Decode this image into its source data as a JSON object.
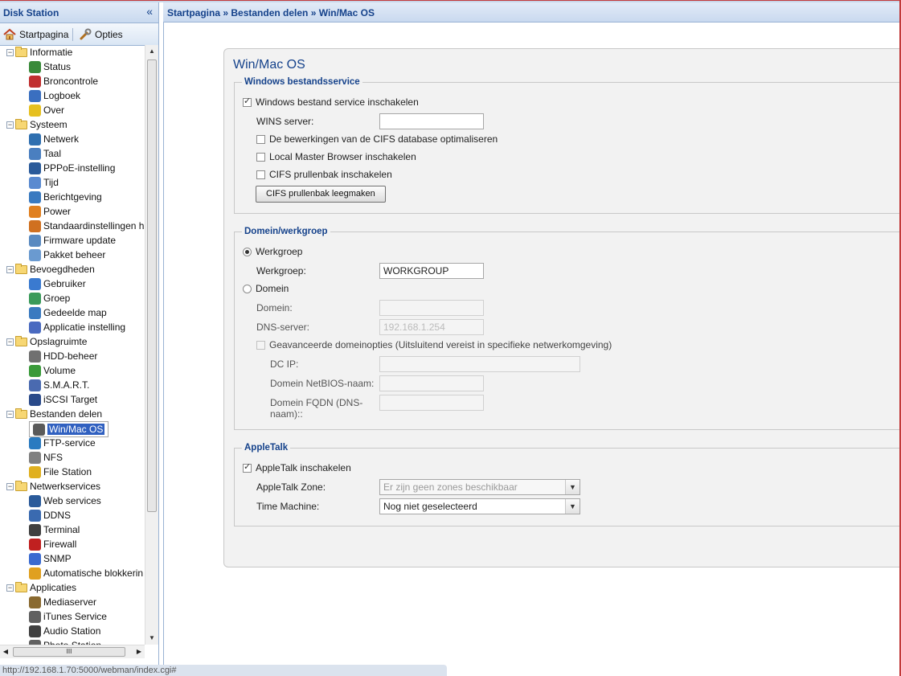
{
  "sidebar": {
    "title": "Disk Station",
    "collapse_glyph": "«",
    "toolbar": {
      "home_label": "Startpagina",
      "options_label": "Opties"
    },
    "tree": [
      {
        "type": "folder",
        "label": "Informatie"
      },
      {
        "type": "item",
        "label": "Status",
        "icon": "status-icon",
        "color": "#3a8a3a"
      },
      {
        "type": "item",
        "label": "Broncontrole",
        "icon": "resource-monitor-icon",
        "color": "#c03030"
      },
      {
        "type": "item",
        "label": "Logboek",
        "icon": "log-icon",
        "color": "#3a6fc0"
      },
      {
        "type": "item",
        "label": "Over",
        "icon": "lightbulb-icon",
        "color": "#e6c020"
      },
      {
        "type": "folder",
        "label": "Systeem"
      },
      {
        "type": "item",
        "label": "Netwerk",
        "icon": "network-icon",
        "color": "#2f6fb0"
      },
      {
        "type": "item",
        "label": "Taal",
        "icon": "language-icon",
        "color": "#4a7fc0"
      },
      {
        "type": "item",
        "label": "PPPoE-instelling",
        "icon": "pppoe-icon",
        "color": "#2a5a9a"
      },
      {
        "type": "item",
        "label": "Tijd",
        "icon": "clock-icon",
        "color": "#5a8ad0"
      },
      {
        "type": "item",
        "label": "Berichtgeving",
        "icon": "notification-icon",
        "color": "#3a7ac0"
      },
      {
        "type": "item",
        "label": "Power",
        "icon": "power-icon",
        "color": "#e08020"
      },
      {
        "type": "item",
        "label": "Standaardinstellingen h",
        "icon": "restore-defaults-icon",
        "color": "#d07020"
      },
      {
        "type": "item",
        "label": "Firmware update",
        "icon": "firmware-icon",
        "color": "#5a8ac0"
      },
      {
        "type": "item",
        "label": "Pakket beheer",
        "icon": "package-icon",
        "color": "#6a9ad0"
      },
      {
        "type": "folder",
        "label": "Bevoegdheden"
      },
      {
        "type": "item",
        "label": "Gebruiker",
        "icon": "user-icon",
        "color": "#3a7ad0"
      },
      {
        "type": "item",
        "label": "Groep",
        "icon": "group-icon",
        "color": "#3a9a5a"
      },
      {
        "type": "item",
        "label": "Gedeelde map",
        "icon": "shared-folder-icon",
        "color": "#3a7ac0"
      },
      {
        "type": "item",
        "label": "Applicatie instelling",
        "icon": "application-settings-icon",
        "color": "#4a6ac0"
      },
      {
        "type": "folder",
        "label": "Opslagruimte"
      },
      {
        "type": "item",
        "label": "HDD-beheer",
        "icon": "hdd-icon",
        "color": "#707070"
      },
      {
        "type": "item",
        "label": "Volume",
        "icon": "volume-icon",
        "color": "#3a9a3a"
      },
      {
        "type": "item",
        "label": "S.M.A.R.T.",
        "icon": "smart-icon",
        "color": "#4a6ab0"
      },
      {
        "type": "item",
        "label": "iSCSI Target",
        "icon": "iscsi-icon",
        "color": "#2a4a8a"
      },
      {
        "type": "folder",
        "label": "Bestanden delen"
      },
      {
        "type": "item",
        "label": "Win/Mac OS",
        "icon": "win-mac-icon",
        "color": "#5a5a5a",
        "selected": true
      },
      {
        "type": "item",
        "label": "FTP-service",
        "icon": "ftp-icon",
        "color": "#2a7ac0"
      },
      {
        "type": "item",
        "label": "NFS",
        "icon": "nfs-icon",
        "color": "#808080"
      },
      {
        "type": "item",
        "label": "File Station",
        "icon": "file-station-icon",
        "color": "#e0b020"
      },
      {
        "type": "folder",
        "label": "Netwerkservices"
      },
      {
        "type": "item",
        "label": "Web services",
        "icon": "web-services-icon",
        "color": "#2a5a9a"
      },
      {
        "type": "item",
        "label": "DDNS",
        "icon": "ddns-icon",
        "color": "#3a6ab0"
      },
      {
        "type": "item",
        "label": "Terminal",
        "icon": "terminal-icon",
        "color": "#404040"
      },
      {
        "type": "item",
        "label": "Firewall",
        "icon": "firewall-icon",
        "color": "#c02020"
      },
      {
        "type": "item",
        "label": "SNMP",
        "icon": "snmp-icon",
        "color": "#3a6ad0"
      },
      {
        "type": "item",
        "label": "Automatische blokkerin",
        "icon": "lock-icon",
        "color": "#e0a020"
      },
      {
        "type": "folder",
        "label": "Applicaties"
      },
      {
        "type": "item",
        "label": "Mediaserver",
        "icon": "media-server-icon",
        "color": "#8a6a30"
      },
      {
        "type": "item",
        "label": "iTunes Service",
        "icon": "headphones-icon",
        "color": "#606060"
      },
      {
        "type": "item",
        "label": "Audio Station",
        "icon": "music-note-icon",
        "color": "#404040"
      },
      {
        "type": "item",
        "label": "Photo Station",
        "icon": "photo-icon",
        "color": "#606060"
      }
    ]
  },
  "breadcrumb": "Startpagina » Bestanden delen » Win/Mac OS",
  "panel": {
    "title": "Win/Mac OS",
    "windows": {
      "legend": "Windows bestandsservice",
      "enable_label": "Windows bestand service inschakelen",
      "enable_checked": true,
      "wins_label": "WINS server:",
      "wins_value": "",
      "cifs_opt_label": "De bewerkingen van de CIFS database optimaliseren",
      "local_master_label": "Local Master Browser inschakelen",
      "recycle_label": "CIFS prullenbak inschakelen",
      "empty_button": "CIFS prullenbak leegmaken"
    },
    "domain": {
      "legend": "Domein/werkgroep",
      "workgroup_radio": "Werkgroep",
      "workgroup_label": "Werkgroep:",
      "workgroup_value": "WORKGROUP",
      "domain_radio": "Domein",
      "domain_label": "Domein:",
      "domain_value": "",
      "dns_label": "DNS-server:",
      "dns_value": "192.168.1.254",
      "advanced_label": "Geavanceerde domeinopties (Uitsluitend vereist in specifieke netwerkomgeving)",
      "dcip_label": "DC IP:",
      "netbios_label": "Domein NetBIOS-naam:",
      "fqdn_label_1": "Domein FQDN (DNS-",
      "fqdn_label_2": "naam)::"
    },
    "appletalk": {
      "legend": "AppleTalk",
      "enable_label": "AppleTalk inschakelen",
      "enable_checked": true,
      "zone_label": "AppleTalk Zone:",
      "zone_value": "Er zijn geen zones beschikbaar",
      "tm_label": "Time Machine:",
      "tm_value": "Nog niet geselecteerd"
    }
  },
  "status_bar": "http://192.168.1.70:5000/webman/index.cgi#"
}
